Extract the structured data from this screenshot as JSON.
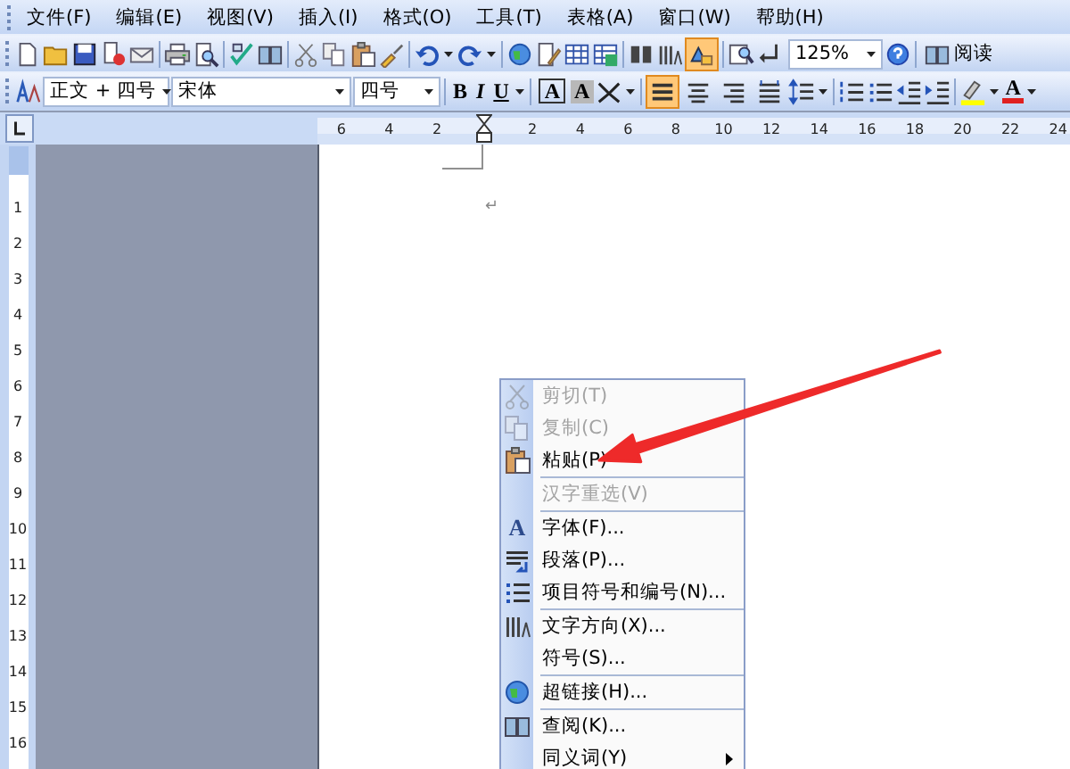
{
  "menu_bar": [
    {
      "label": "文件(F)"
    },
    {
      "label": "编辑(E)"
    },
    {
      "label": "视图(V)"
    },
    {
      "label": "插入(I)"
    },
    {
      "label": "格式(O)"
    },
    {
      "label": "工具(T)"
    },
    {
      "label": "表格(A)"
    },
    {
      "label": "窗口(W)"
    },
    {
      "label": "帮助(H)"
    }
  ],
  "standard_toolbar": {
    "drawing_button": {
      "on": true
    },
    "zoom": "125%",
    "read_button": "阅读"
  },
  "formatting_toolbar": {
    "style": "正文 + 四号",
    "font": "宋体",
    "size": "四号",
    "bold": "B",
    "italic": "I",
    "underline": "U",
    "border_char": "A",
    "shading_char": "A",
    "alignment": [
      {
        "selected": true
      },
      {
        "selected": false
      },
      {
        "selected": false
      },
      {
        "selected": false
      }
    ],
    "font_color": "A"
  },
  "ruler": {
    "left_labels": [
      "6",
      "4",
      "2"
    ],
    "right_labels": [
      "2",
      "4",
      "6",
      "8",
      "10",
      "12",
      "14",
      "16",
      "18",
      "20",
      "22",
      "24"
    ]
  },
  "vertical_ruler": {
    "labels": [
      "1",
      "2",
      "3",
      "4",
      "5",
      "6",
      "7",
      "8",
      "9",
      "10",
      "11",
      "12",
      "13",
      "14",
      "15",
      "16"
    ]
  },
  "document": {
    "paragraph_mark": "↵"
  },
  "context_menu": {
    "groups": [
      [
        {
          "label": "剪切(T)",
          "disabled": true,
          "submenu": false
        },
        {
          "label": "复制(C)",
          "disabled": true,
          "submenu": false
        },
        {
          "label": "粘贴(P)",
          "disabled": false,
          "submenu": false
        }
      ],
      [
        {
          "label": "汉字重选(V)",
          "disabled": true,
          "submenu": false
        }
      ],
      [
        {
          "label": "字体(F)...",
          "disabled": false,
          "submenu": false,
          "icon_char": "A"
        },
        {
          "label": "段落(P)...",
          "disabled": false,
          "submenu": false
        },
        {
          "label": "项目符号和编号(N)...",
          "disabled": false,
          "submenu": false
        }
      ],
      [
        {
          "label": "文字方向(X)...",
          "disabled": false,
          "submenu": false
        },
        {
          "label": "符号(S)...",
          "disabled": false,
          "submenu": false
        }
      ],
      [
        {
          "label": "超链接(H)...",
          "disabled": false,
          "submenu": false
        }
      ],
      [
        {
          "label": "查阅(K)...",
          "disabled": false,
          "submenu": false
        },
        {
          "label": "同义词(Y)",
          "disabled": false,
          "submenu": true
        }
      ]
    ]
  }
}
